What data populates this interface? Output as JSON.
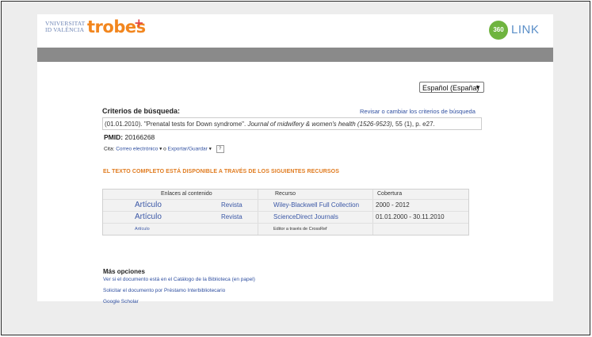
{
  "header": {
    "uv_line1": "VNIVERSITAT",
    "uv_line2": "ID VALÈNCIA",
    "trobes": "trobes",
    "trobes_plus": "+",
    "link_badge": "360",
    "link_text": "LINK"
  },
  "language": {
    "selected": "Español (España)"
  },
  "criteria": {
    "title": "Criterios de búsqueda:",
    "revise_link": "Revisar o cambiar los criterios de búsqueda",
    "citation_plain": "(01.01.2010). \"Prenatal tests for Down syndrome\". ",
    "citation_journal": "Journal of midwifery & women's health (1526-9523)",
    "citation_tail": ", 55 (1), p. e27.",
    "pmid_label": "PMID:",
    "pmid_value": "20166268",
    "cita_label": "Cita:",
    "cita_email": "Correo electrónico",
    "cita_or": "o",
    "cita_export": "Exportar/Guardar",
    "help": "?"
  },
  "fulltext_heading": "EL TEXTO COMPLETO ESTÁ DISPONIBLE A TRAVÉS DE LOS SIGUIENTES RECURSOS",
  "table": {
    "headers": {
      "links": "Enlaces al contenido",
      "resource": "Recurso",
      "coverage": "Cobertura"
    },
    "rows": [
      {
        "article": "Artículo",
        "journal": "Revista",
        "resource": "Wiley-Blackwell Full Collection",
        "coverage": "2000 - 2012"
      },
      {
        "article": "Artículo",
        "journal": "Revista",
        "resource": "ScienceDirect Journals",
        "coverage": "01.01.2000 - 30.11.2010"
      },
      {
        "article": "Artículo",
        "journal": "",
        "resource": "Editor a través de CrossRef",
        "coverage": ""
      }
    ]
  },
  "more": {
    "title": "Más opciones",
    "links": [
      "Ver si el documento está en el Catálogo de la Biblioteca (en papel)",
      "Solicitar el documento por Préstamo Interbibliotecario",
      "Google Scholar"
    ]
  }
}
